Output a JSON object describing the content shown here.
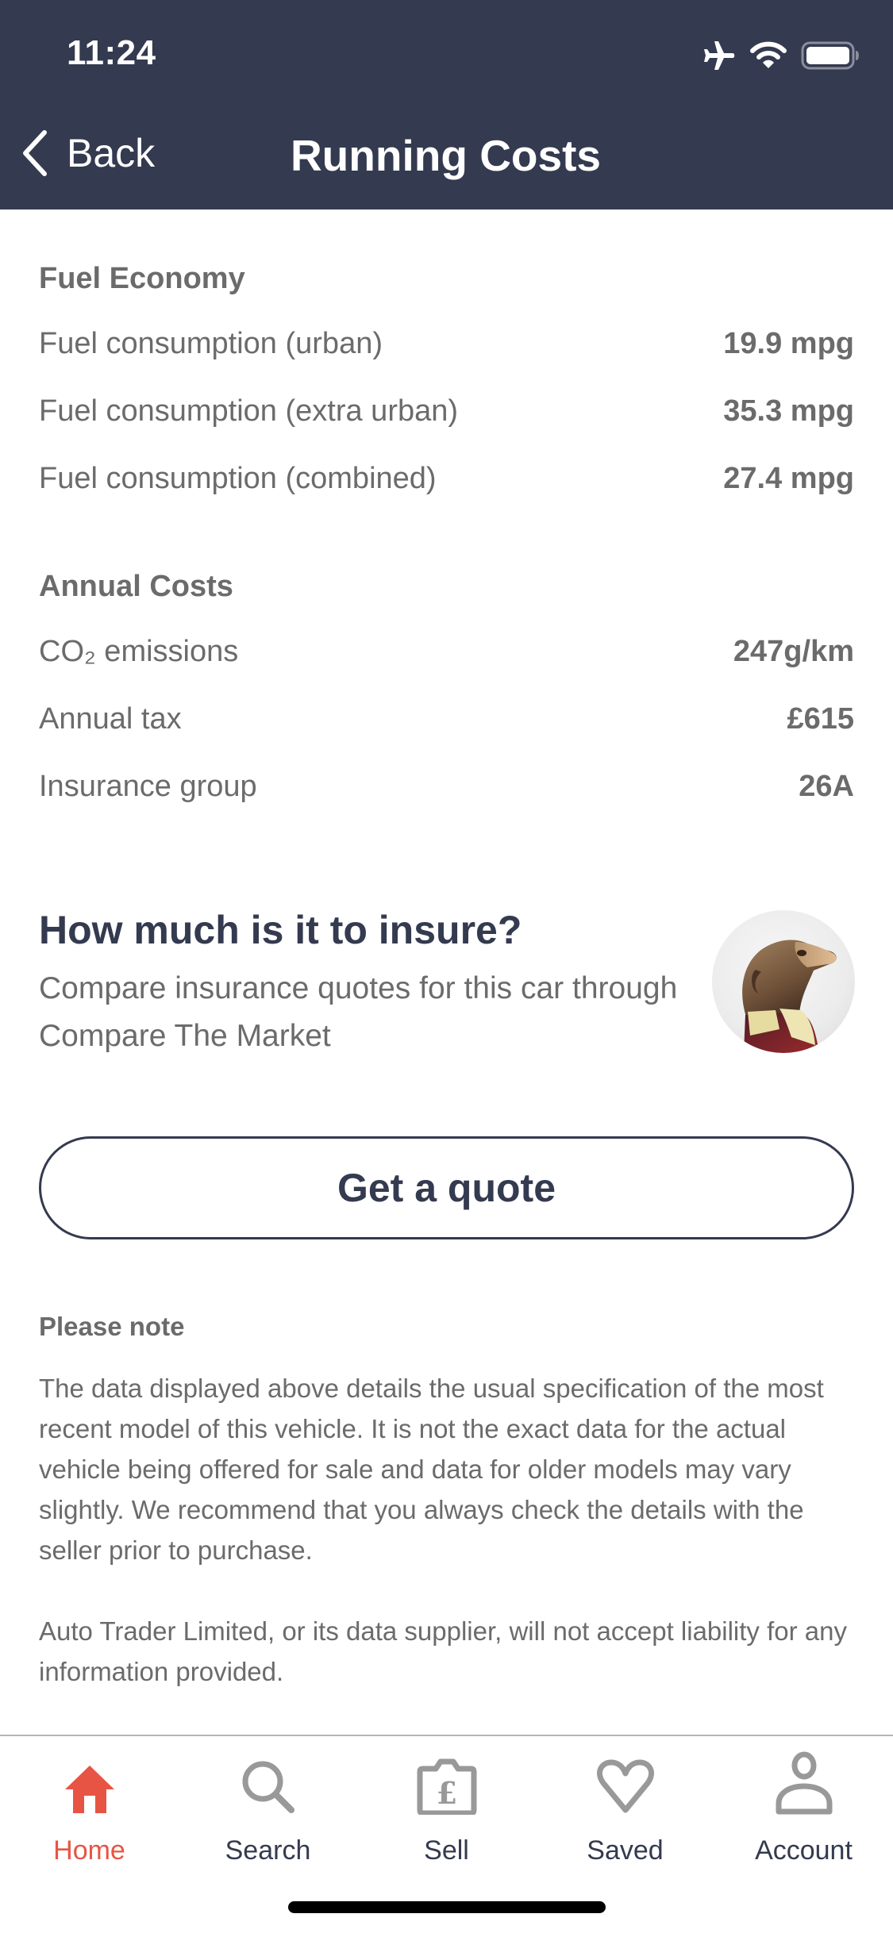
{
  "status_bar": {
    "time": "11:24",
    "icons": [
      "airplane-mode-icon",
      "wifi-icon",
      "battery-icon"
    ]
  },
  "nav": {
    "back_label": "Back",
    "title": "Running Costs"
  },
  "fuel_economy": {
    "title": "Fuel Economy",
    "rows": [
      {
        "label": "Fuel consumption (urban)",
        "value": "19.9 mpg"
      },
      {
        "label": "Fuel consumption (extra urban)",
        "value": "35.3 mpg"
      },
      {
        "label": "Fuel consumption (combined)",
        "value": "27.4 mpg"
      }
    ]
  },
  "annual_costs": {
    "title": "Annual Costs",
    "rows": [
      {
        "label": "CO₂ emissions",
        "value": "247g/km"
      },
      {
        "label": "Annual tax",
        "value": "£615"
      },
      {
        "label": "Insurance group",
        "value": "26A"
      }
    ]
  },
  "insurance_promo": {
    "heading": "How much is it to insure?",
    "subtext": "Compare insurance quotes for this car through Compare The Market",
    "button_label": "Get a quote"
  },
  "note": {
    "title": "Please note",
    "paragraphs": [
      "The data displayed above details the usual specification of the most recent model of this vehicle. It is not the exact data for the actual vehicle being offered for sale and data for older models may vary slightly. We recommend that you always check the details with the seller prior to purchase.",
      "Auto Trader Limited, or its data supplier, will not accept liability for any information provided."
    ]
  },
  "tabbar": {
    "items": [
      {
        "label": "Home",
        "icon": "home-icon",
        "active": true
      },
      {
        "label": "Search",
        "icon": "search-icon",
        "active": false
      },
      {
        "label": "Sell",
        "icon": "sell-camera-pound-icon",
        "active": false
      },
      {
        "label": "Saved",
        "icon": "heart-icon",
        "active": false
      },
      {
        "label": "Account",
        "icon": "account-icon",
        "active": false
      }
    ]
  },
  "colors": {
    "header_bg": "#343a4f",
    "accent": "#e85444",
    "text_gray": "#6b6b6b",
    "icon_gray": "#999999"
  }
}
